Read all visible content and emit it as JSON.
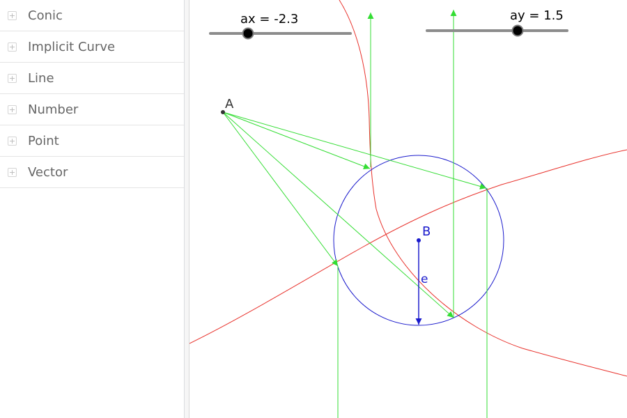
{
  "algebra_view": {
    "categories": [
      {
        "label": "Conic"
      },
      {
        "label": "Implicit Curve"
      },
      {
        "label": "Line"
      },
      {
        "label": "Number"
      },
      {
        "label": "Point"
      },
      {
        "label": "Vector"
      }
    ]
  },
  "graphics": {
    "sliders": [
      {
        "caption": "ax = -2.3",
        "name": "ax",
        "value": -2.3
      },
      {
        "caption": "ay = 1.5",
        "name": "ay",
        "value": 1.5
      }
    ],
    "labels": {
      "point_a": "A",
      "point_b": "B",
      "vector_e": "e"
    },
    "colors": {
      "curve": "#e8302a",
      "circle": "#1a1acc",
      "vectors": "#33dd33",
      "vector_e": "#1a1acc",
      "point": "#333333"
    }
  }
}
